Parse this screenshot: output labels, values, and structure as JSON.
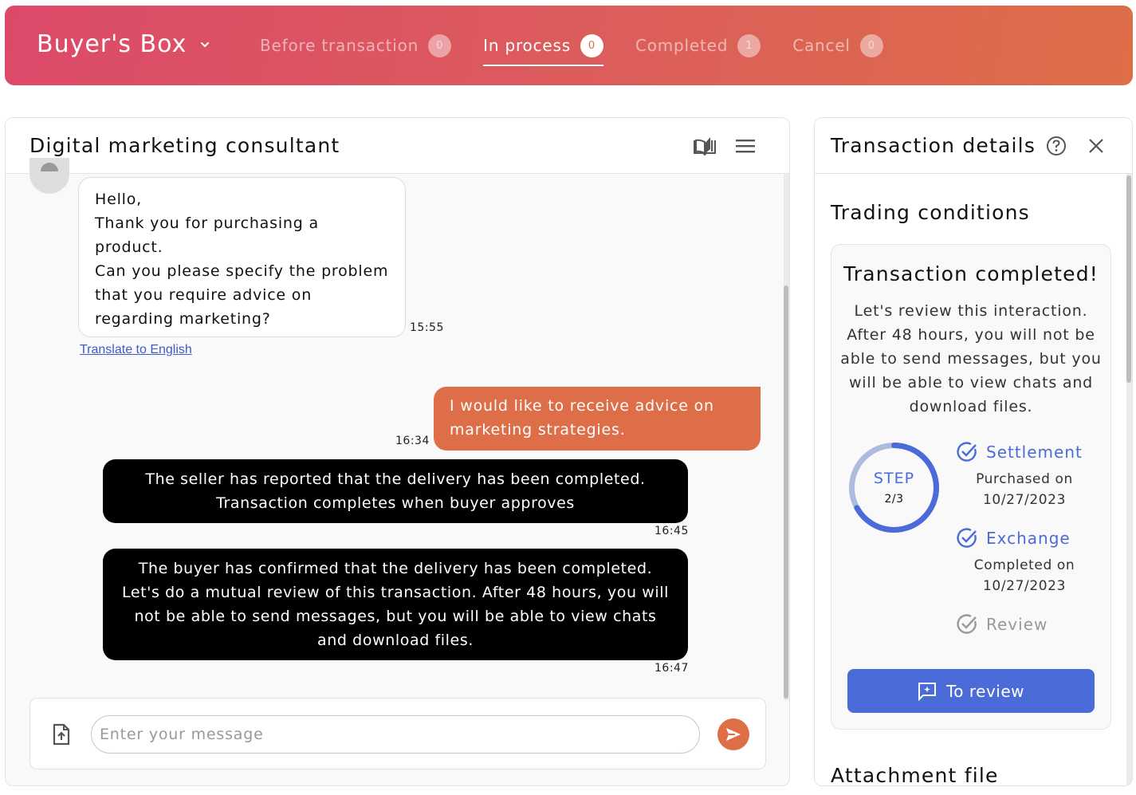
{
  "header": {
    "brand": "Buyer's Box",
    "tabs": [
      {
        "label": "Before transaction",
        "count": "0",
        "active": false
      },
      {
        "label": "In process",
        "count": "0",
        "active": true
      },
      {
        "label": "Completed",
        "count": "1",
        "active": false
      },
      {
        "label": "Cancel",
        "count": "0",
        "active": false
      }
    ]
  },
  "chat": {
    "title": "Digital marketing consultant",
    "icons": [
      "book-icon",
      "menu-icon"
    ],
    "messages": [
      {
        "type": "incoming",
        "text": "Hello,\nThank you for purchasing a product.\nCan you please specify the problem that you require advice on regarding marketing?",
        "time": "15:55",
        "translate_label": "Translate to English"
      },
      {
        "type": "outgoing",
        "text": "I would like to receive advice on marketing strategies.",
        "time": "16:34"
      },
      {
        "type": "system",
        "text": "The seller has reported that the delivery has been completed. Transaction completes when buyer approves",
        "time": "16:45"
      },
      {
        "type": "system",
        "text": "The buyer has confirmed that the delivery has been completed. Let's do a mutual review of this transaction. After 48 hours, you will not be able to send messages, but you will be able to view chats and download files.",
        "time": "16:47"
      }
    ],
    "composer": {
      "placeholder": "Enter your message",
      "value": ""
    }
  },
  "details": {
    "title": "Transaction details",
    "section_title": "Trading conditions",
    "card": {
      "title": "Transaction completed!",
      "text": "Let's review this interaction. After 48 hours, you will not be able to send messages, but you will be able to view chats and download files.",
      "step_label": "STEP",
      "step_count": "2/3",
      "step_progress": 0.67,
      "steps": [
        {
          "label": "Settlement",
          "sub1": "Purchased on",
          "sub2": "10/27/2023",
          "status": "done"
        },
        {
          "label": "Exchange",
          "sub1": "Completed on",
          "sub2": "10/27/2023",
          "status": "done"
        },
        {
          "label": "Review",
          "status": "pending"
        }
      ],
      "button_label": "To review"
    },
    "attachment_title": "Attachment file"
  },
  "colors": {
    "accent_orange": "#dd6e48",
    "accent_blue": "#4a6bd8",
    "header_start": "#dc4a6a",
    "header_end": "#dd6e48"
  }
}
